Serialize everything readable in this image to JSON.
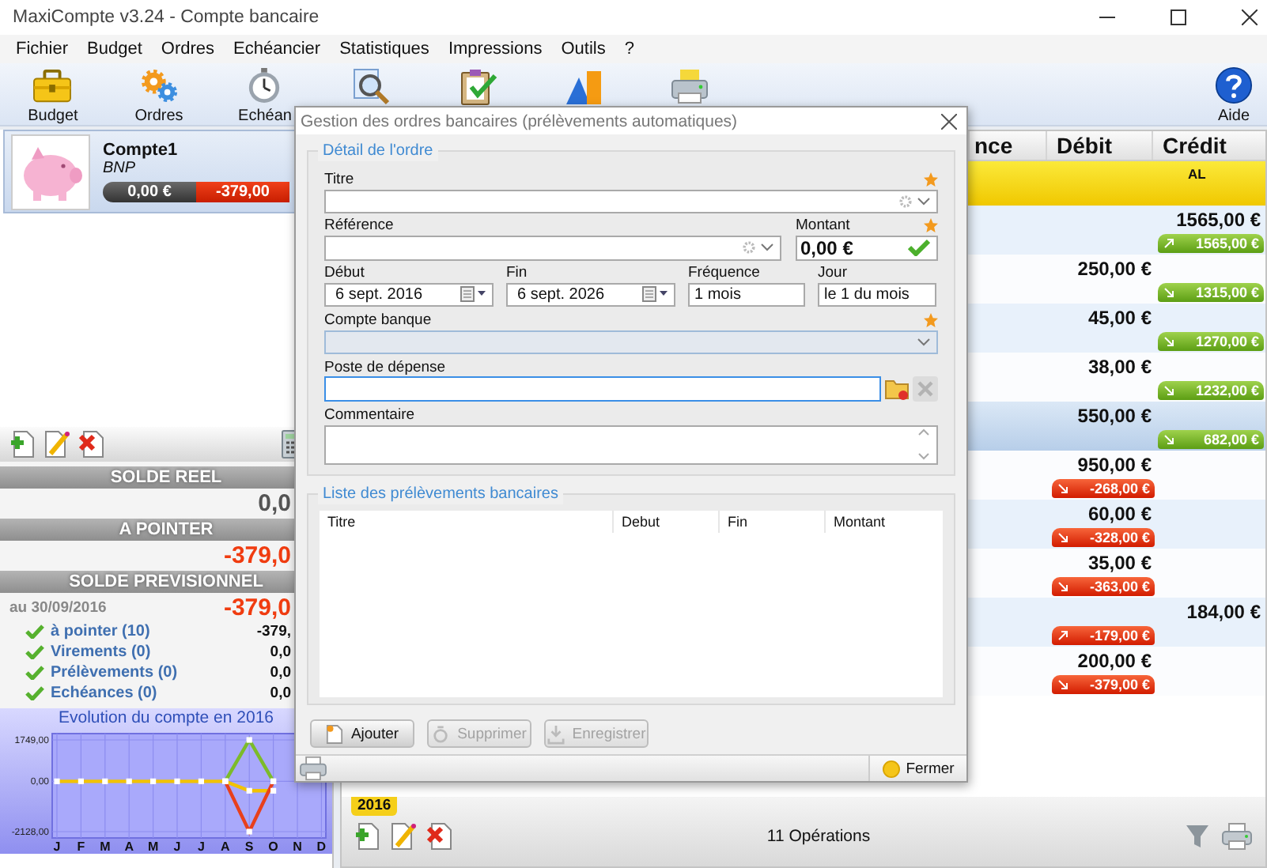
{
  "window": {
    "title": "MaxiCompte v3.24 - Compte bancaire"
  },
  "menu": [
    "Fichier",
    "Budget",
    "Ordres",
    "Echéancier",
    "Statistiques",
    "Impressions",
    "Outils",
    "?"
  ],
  "toolbar": [
    {
      "label": "Budget"
    },
    {
      "label": "Ordres"
    },
    {
      "label": "Echéan"
    }
  ],
  "help": {
    "label": "Aide"
  },
  "account": {
    "name": "Compte1",
    "bank": "BNP",
    "balance": "0,00 €",
    "forecast": "-379,00"
  },
  "summary": {
    "sections": [
      {
        "heading": "SOLDE REEL",
        "value": "0,0",
        "negative": false
      },
      {
        "heading": "A POINTER",
        "value": "-379,0",
        "negative": true
      },
      {
        "heading": "SOLDE PREVISIONNEL",
        "date": "au 30/09/2016",
        "value": "-379,0",
        "negative": true
      }
    ],
    "items": [
      {
        "label": "à pointer (10)",
        "value": "-379,"
      },
      {
        "label": "Virements (0)",
        "value": "0,0"
      },
      {
        "label": "Prélèvements (0)",
        "value": "0,0"
      },
      {
        "label": "Echéances (0)",
        "value": "0,0"
      }
    ]
  },
  "chart": {
    "chart_data": {
      "type": "line",
      "grid": true,
      "title": "Evolution du compte en 2016",
      "categories": [
        "J",
        "F",
        "M",
        "A",
        "M",
        "J",
        "J",
        "A",
        "S",
        "O",
        "N",
        "D"
      ],
      "ylim": [
        -2128,
        1749
      ],
      "yticks": [
        {
          "value": 1749,
          "label": "1749,00"
        },
        {
          "value": 0,
          "label": "0,00"
        },
        {
          "value": -2128,
          "label": "-2128,00"
        }
      ],
      "series": [
        {
          "color": "#f2c200",
          "marker": "square",
          "values": [
            0,
            0,
            0,
            0,
            0,
            0,
            0,
            0,
            -400,
            -400,
            null,
            null
          ]
        },
        {
          "color": "#7cbb2a",
          "marker": "square",
          "values": [
            null,
            null,
            null,
            null,
            null,
            null,
            null,
            0,
            1749,
            0,
            null,
            null
          ]
        },
        {
          "color": "#e8401c",
          "marker": "square",
          "values": [
            null,
            null,
            null,
            null,
            null,
            null,
            null,
            0,
            -2128,
            0,
            null,
            null
          ]
        }
      ]
    }
  },
  "dialog": {
    "title": "Gestion des ordres bancaires (prélèvements automatiques)",
    "detail": {
      "legend": "Détail de l'ordre",
      "titre": {
        "label": "Titre",
        "required": true
      },
      "reference": {
        "label": "Référence"
      },
      "montant": {
        "label": "Montant",
        "required": true,
        "value": "0,00 €",
        "valid": true
      },
      "debut": {
        "label": "Début",
        "value": "6 sept. 2016"
      },
      "fin": {
        "label": "Fin",
        "value": "6 sept. 2026"
      },
      "frequence": {
        "label": "Fréquence",
        "value": "1 mois"
      },
      "jour": {
        "label": "Jour",
        "value": "le 1 du mois"
      },
      "compte_banque": {
        "label": "Compte banque",
        "required": true
      },
      "poste": {
        "label": "Poste de dépense",
        "focused": true
      },
      "commentaire": {
        "label": "Commentaire"
      }
    },
    "list": {
      "legend": "Liste des prélèvements bancaires",
      "columns": [
        "Titre",
        "Debut",
        "Fin",
        "Montant"
      ]
    },
    "buttons": [
      {
        "label": "Ajouter",
        "disabled": false
      },
      {
        "label": "Supprimer",
        "disabled": true
      },
      {
        "label": "Enregistrer",
        "disabled": true
      }
    ],
    "close": {
      "label": "Fermer"
    }
  },
  "ledger": {
    "columns": [
      "nce",
      "Débit",
      "Crédit"
    ],
    "group": {
      "label": "AL"
    },
    "rows": [
      {
        "credit": "1565,00 €",
        "balance": "1565,00 €",
        "negative": false,
        "rising": true,
        "selected": false
      },
      {
        "debit": "250,00 €",
        "balance": "1315,00 €",
        "negative": false,
        "rising": false,
        "selected": false
      },
      {
        "debit": "45,00 €",
        "balance": "1270,00 €",
        "negative": false,
        "rising": false,
        "selected": false
      },
      {
        "debit": "38,00 €",
        "balance": "1232,00 €",
        "negative": false,
        "rising": false,
        "selected": false
      },
      {
        "debit": "550,00 €",
        "balance": "682,00 €",
        "negative": false,
        "rising": false,
        "selected": true
      },
      {
        "debit": "950,00 €",
        "balance": "-268,00 €",
        "negative": true,
        "rising": false,
        "selected": false
      },
      {
        "debit": "60,00 €",
        "balance": "-328,00 €",
        "negative": true,
        "rising": false,
        "selected": false
      },
      {
        "debit": "35,00 €",
        "balance": "-363,00 €",
        "negative": true,
        "rising": false,
        "selected": false
      },
      {
        "credit": "184,00 €",
        "balance": "-179,00 €",
        "negative": true,
        "rising": true,
        "selected": false
      },
      {
        "debit": "200,00 €",
        "balance": "-379,00 €",
        "negative": true,
        "rising": false,
        "selected": false
      }
    ],
    "year_tab": "2016",
    "count": "11 Opérations"
  }
}
